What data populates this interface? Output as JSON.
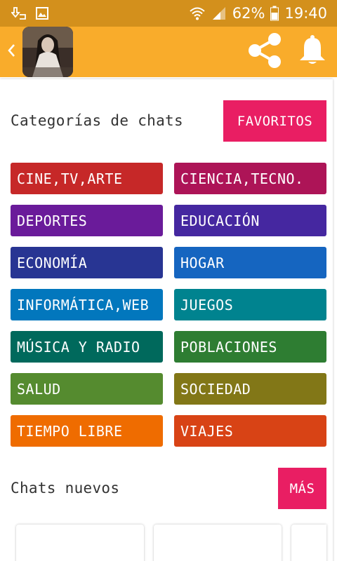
{
  "status_bar": {
    "battery": "62%",
    "time": "19:40",
    "icons": [
      "download-icon",
      "image-icon",
      "wifi-icon",
      "signal-icon",
      "battery-icon"
    ]
  },
  "app_bar": {
    "icons": [
      "back-icon",
      "share-icon",
      "bell-icon"
    ]
  },
  "categories_section": {
    "title": "Categorías de chats",
    "favorites_label": "FAVORITOS"
  },
  "categories": [
    {
      "label": "CINE,TV,ARTE",
      "color": "#c62828"
    },
    {
      "label": "CIENCIA,TECNO.",
      "color": "#ad1457"
    },
    {
      "label": "DEPORTES",
      "color": "#6a1b9a"
    },
    {
      "label": "EDUCACIÓN",
      "color": "#4527a0"
    },
    {
      "label": "ECONOMÍA",
      "color": "#283593"
    },
    {
      "label": "HOGAR",
      "color": "#1565c0"
    },
    {
      "label": "INFORMÁTICA,WEB",
      "color": "#0277bd"
    },
    {
      "label": "JUEGOS",
      "color": "#00838f"
    },
    {
      "label": "MÚSICA Y RADIO",
      "color": "#00695c"
    },
    {
      "label": "POBLACIONES",
      "color": "#2e7d32"
    },
    {
      "label": "SALUD",
      "color": "#558b2f"
    },
    {
      "label": "SOCIEDAD",
      "color": "#827717"
    },
    {
      "label": "TIEMPO LIBRE",
      "color": "#ef6c00"
    },
    {
      "label": "VIAJES",
      "color": "#d84315"
    }
  ],
  "new_chats_section": {
    "title": "Chats nuevos",
    "more_label": "MÁS"
  },
  "colors": {
    "status_bar": "#d3901c",
    "app_bar": "#f9ac2b",
    "accent": "#e91e63"
  }
}
